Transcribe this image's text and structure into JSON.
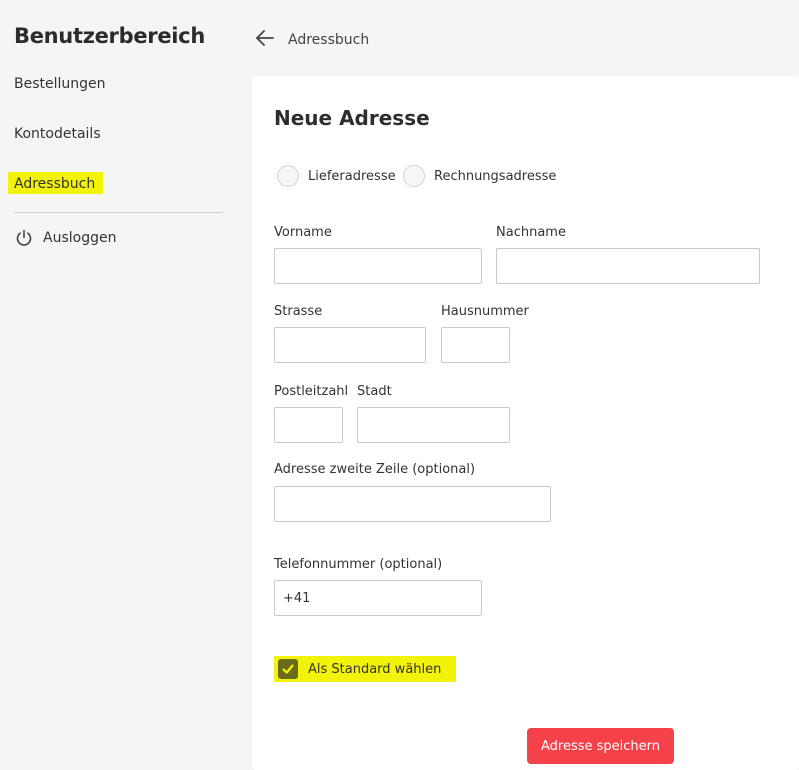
{
  "sidebar": {
    "title": "Benutzerbereich",
    "items": [
      {
        "label": "Bestellungen"
      },
      {
        "label": "Kontodetails"
      },
      {
        "label": "Adressbuch"
      }
    ],
    "logout_label": "Ausloggen"
  },
  "header": {
    "back_label": "Adressbuch"
  },
  "form": {
    "title": "Neue Adresse",
    "radios": [
      {
        "label": "Lieferadresse"
      },
      {
        "label": "Rechnungsadresse"
      }
    ],
    "fields": {
      "vorname": {
        "label": "Vorname",
        "value": ""
      },
      "nachname": {
        "label": "Nachname",
        "value": ""
      },
      "strasse": {
        "label": "Strasse",
        "value": ""
      },
      "hausnummer": {
        "label": "Hausnummer",
        "value": ""
      },
      "plz": {
        "label": "Postleitzahl",
        "value": ""
      },
      "stadt": {
        "label": "Stadt",
        "value": ""
      },
      "adresse2": {
        "label": "Adresse zweite Zeile (optional)",
        "value": ""
      },
      "telefon": {
        "label": "Telefonnummer (optional)",
        "value": "+41"
      }
    },
    "default_checkbox": {
      "label": "Als Standard wählen",
      "checked": true
    },
    "save_label": "Adresse speichern"
  },
  "colors": {
    "highlight": "#f2f20a",
    "save_button": "#f5424a",
    "checkbox": "#6b6a18"
  }
}
